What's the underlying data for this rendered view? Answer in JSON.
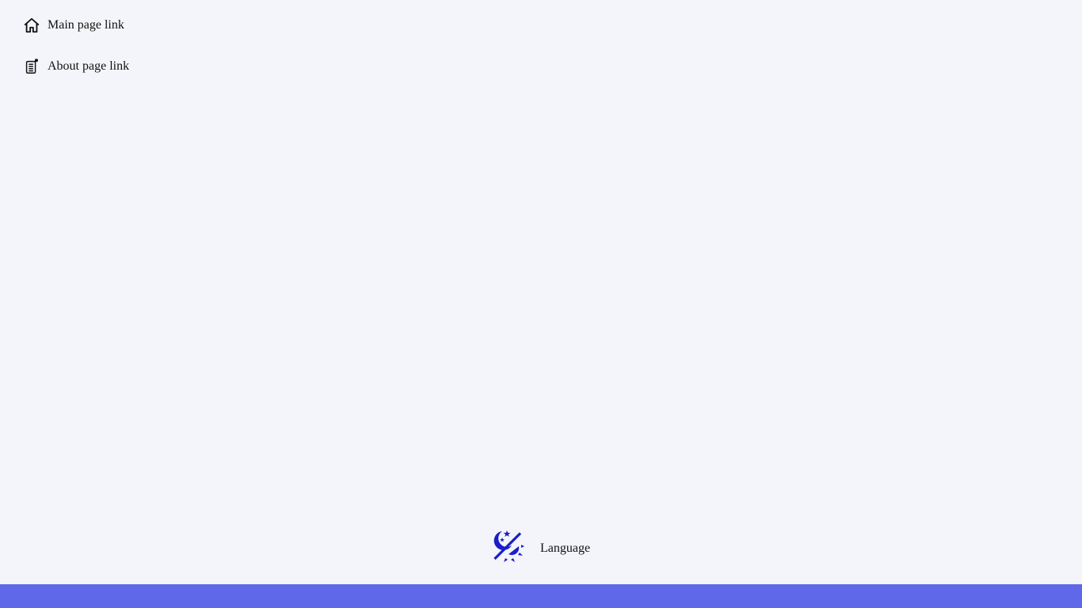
{
  "nav": {
    "items": [
      {
        "label": "Main page link",
        "icon": "home-icon"
      },
      {
        "label": "About page link",
        "icon": "document-icon"
      }
    ]
  },
  "language": {
    "label": "Language",
    "icon": "theme-toggle-icon",
    "icon_color": "#1a1fc8"
  },
  "colors": {
    "background": "#f3f5fa",
    "footer_bar": "#5f68e8"
  }
}
